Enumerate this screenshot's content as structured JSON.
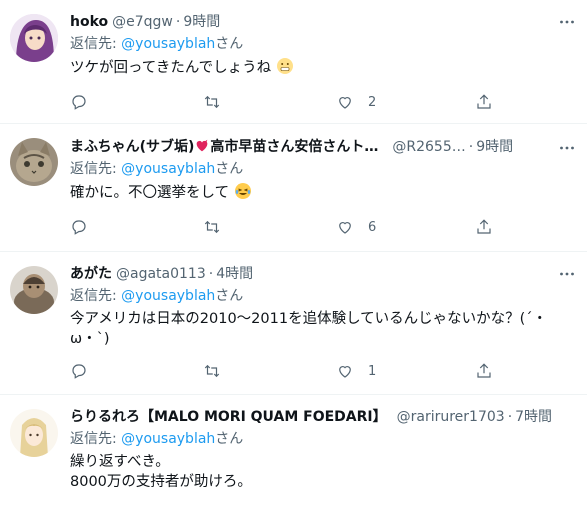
{
  "tweets": [
    {
      "name": "hoko",
      "handle": "@e7qgw",
      "time": "9時間",
      "reply_prefix": "返信先: ",
      "reply_mention": "@yousayblah",
      "reply_suffix": "さん",
      "text": "ツケが回ってきたんでしょうね",
      "like_count": "2",
      "avatar_color": "#c9a3d6"
    },
    {
      "name_part1": "まふちゃん(サブ垢)",
      "name_part2": "高市早苗さん安倍さんト…",
      "handle": "@R2655…",
      "time": "9時間",
      "reply_prefix": "返信先: ",
      "reply_mention": "@yousayblah",
      "reply_suffix": "さん",
      "text": "確かに。不〇選挙をして",
      "like_count": "6"
    },
    {
      "name": "あがた",
      "handle": "@agata0113",
      "time": "4時間",
      "reply_prefix": "返信先: ",
      "reply_mention": "@yousayblah",
      "reply_suffix": "さん",
      "text": "今アメリカは日本の2010〜2011を追体験しているんじゃないかな？(´・ω・`)",
      "like_count": "1"
    },
    {
      "name": "らりるれろ【MALO MORI QUAM FOEDARI】",
      "handle": "@rarirurer1703",
      "time": "7時間",
      "reply_prefix": "返信先: ",
      "reply_mention": "@yousayblah",
      "reply_suffix": "さん",
      "text_line1": "繰り返すべき。",
      "text_line2": "8000万の支持者が助けろ。"
    }
  ],
  "colors": {
    "link": "#1d9bf0",
    "secondary": "#536471",
    "divider": "#eff3f4"
  },
  "icons": [
    "reply-icon",
    "retweet-icon",
    "like-icon",
    "share-icon",
    "more-icon",
    "heart-emoji",
    "grimace-emoji",
    "laughing-emoji"
  ]
}
